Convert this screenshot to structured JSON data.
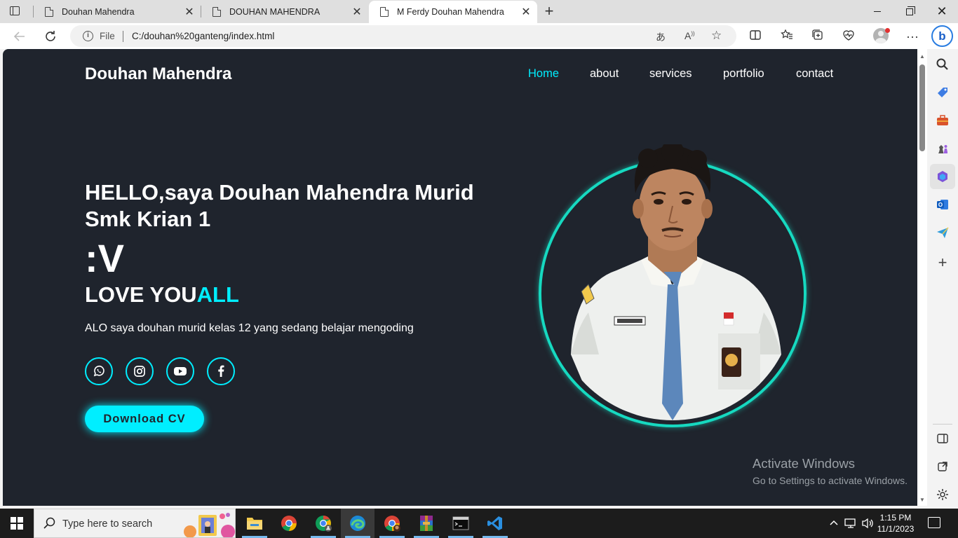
{
  "browser": {
    "tabs": [
      {
        "title": "Douhan Mahendra",
        "active": false
      },
      {
        "title": "DOUHAN MAHENDRA",
        "active": false
      },
      {
        "title": "M Ferdy Douhan Mahendra",
        "active": true
      }
    ],
    "address": {
      "scheme": "File",
      "url": "C:/douhan%20ganteng/index.html"
    }
  },
  "site": {
    "logo": "Douhan Mahendra",
    "nav": [
      {
        "label": "Home",
        "active": true
      },
      {
        "label": "about",
        "active": false
      },
      {
        "label": "services",
        "active": false
      },
      {
        "label": "portfolio",
        "active": false
      },
      {
        "label": "contact",
        "active": false
      }
    ],
    "hero": {
      "greeting": "HELLO,saya Douhan Mahendra Murid Smk Krian 1",
      "smiley": ":V",
      "love_main": "LOVE YOU",
      "love_accent": "ALL",
      "description": "ALO saya douhan murid kelas 12 yang sedang belajar mengoding",
      "socials": [
        "whatsapp-icon",
        "instagram-icon",
        "youtube-icon",
        "facebook-icon"
      ],
      "cv_button": "Download CV"
    },
    "accent_color": "#00eeff",
    "background_color": "#1f242d"
  },
  "watermark": {
    "line1": "Activate Windows",
    "line2": "Go to Settings to activate Windows."
  },
  "taskbar": {
    "search_placeholder": "Type here to search",
    "time": "1:15 PM",
    "date": "11/1/2023"
  }
}
